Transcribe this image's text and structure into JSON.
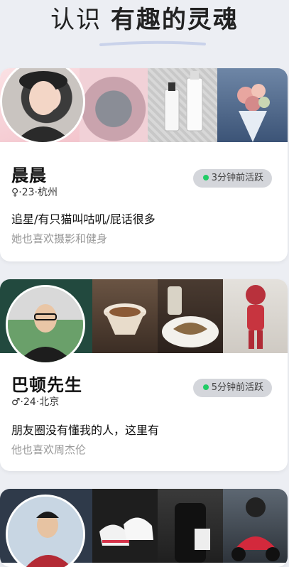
{
  "header": {
    "title_light": "认识 ",
    "title_bold": "有趣的灵魂"
  },
  "profiles": [
    {
      "name": "晨晨",
      "gender_icon": "female-icon",
      "meta": "♀·23·杭州",
      "active": "3分钟前活跃",
      "bio": "追星/有只猫叫咕叽/屁话很多",
      "also_likes": "她也喜欢摄影和健身"
    },
    {
      "name": "巴顿先生",
      "gender_icon": "male-icon",
      "meta": "♂·24·北京",
      "active": "5分钟前活跃",
      "bio": "朋友圈没有懂我的人，这里有",
      "also_likes": "他也喜欢周杰伦"
    }
  ],
  "colors": {
    "active_dot": "#22cc66",
    "badge_bg": "#d4d6db",
    "page_bg": "#eceef3"
  }
}
